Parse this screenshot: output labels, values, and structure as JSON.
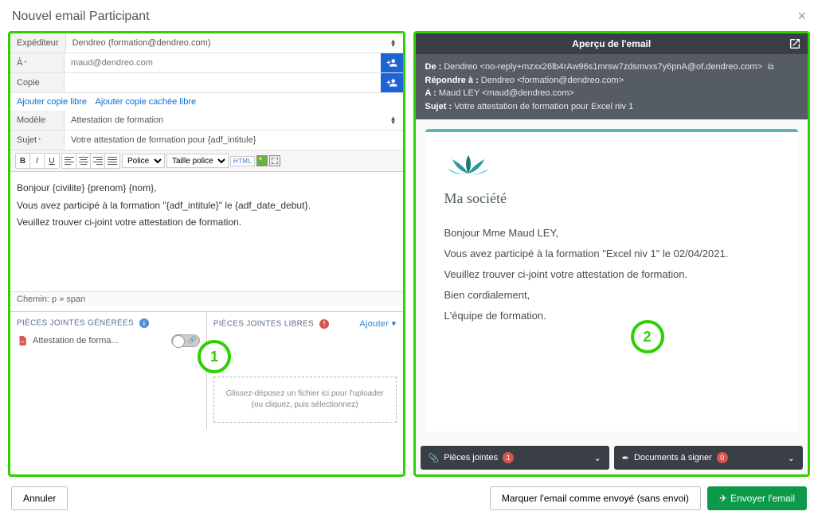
{
  "modal": {
    "title": "Nouvel email Participant",
    "close": "×"
  },
  "form": {
    "sender_label": "Expéditeur",
    "sender_value": "Dendreo (formation@dendreo.com)",
    "to_label": "À",
    "to_placeholder": "maud@dendreo.com",
    "copy_label": "Copie",
    "link_cc": "Ajouter copie libre",
    "link_bcc": "Ajouter copie cachée libre",
    "model_label": "Modèle",
    "model_value": "Attestation de formation",
    "subject_label": "Sujet",
    "subject_value": "Votre attestation de formation pour {adf_intitule}"
  },
  "toolbar": {
    "font_label": "Police",
    "size_label": "Taille police",
    "html_label": "HTML"
  },
  "editor": {
    "line1": "Bonjour {civilite} {prenom} {nom},",
    "line2": "Vous avez participé à la formation \"{adf_intitule}\" le {adf_date_debut}.",
    "line3": "Veuillez trouver ci-joint votre attestation de formation.",
    "path": "Chemin: p » span"
  },
  "attachments": {
    "generated_title": "PIÈCES JOINTES GÉNÉRÉES",
    "generated_item": "Attestation de forma...",
    "free_title": "PIÈCES JOINTES LIBRES",
    "add_label": "Ajouter",
    "dropzone_l1": "Glissez-déposez un fichier ici pour l'uploader",
    "dropzone_l2": "(ou cliquez, puis sélectionnez)"
  },
  "preview": {
    "title": "Aperçu de l'email",
    "from_label": "De :",
    "from_value": "Dendreo <no-reply+mzxx26lb4rAw96s1mrsw7zdsmvxs7y6pnA@of.dendreo.com>",
    "reply_label": "Répondre à :",
    "reply_value": "Dendreo <formation@dendreo.com>",
    "to_label": "A :",
    "to_value": "Maud LEY <maud@dendreo.com>",
    "subject_label": "Sujet :",
    "subject_value": "Votre attestation de formation pour Excel niv 1",
    "company": "Ma société",
    "body_l1": "Bonjour Mme Maud LEY,",
    "body_l2": "Vous avez participé à la formation \"Excel niv 1\" le 02/04/2021.",
    "body_l3": "Veuillez trouver ci-joint votre attestation de formation.",
    "body_l4": "Bien cordialement,",
    "body_l5": "L'équipe de formation.",
    "acc1_label": "Pièces jointes",
    "acc1_badge": "1",
    "acc2_label": "Documents à signer",
    "acc2_badge": "0"
  },
  "footer": {
    "cancel": "Annuler",
    "mark_sent": "Marquer l'email comme envoyé (sans envoi)",
    "send": "Envoyer l'email"
  },
  "circles": {
    "one": "1",
    "two": "2"
  }
}
